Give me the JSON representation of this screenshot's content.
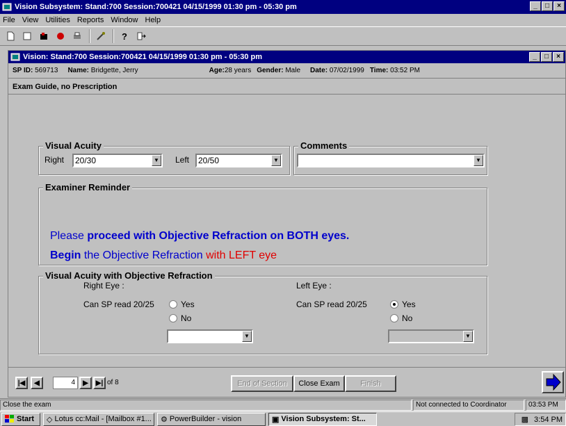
{
  "app": {
    "title": "Vision Subsystem: Stand:700 Session:700421 04/15/1999 01:30 pm - 05:30 pm",
    "window_buttons": [
      "_",
      "□",
      "×"
    ]
  },
  "menu": [
    "File",
    "View",
    "Utilities",
    "Reports",
    "Window",
    "Help"
  ],
  "toolbar_icons": [
    "new-icon",
    "open-icon",
    "save-icon",
    "stop-icon",
    "print-icon",
    "tools-icon",
    "help-icon",
    "exit-icon"
  ],
  "child": {
    "title": "Vision: Stand:700 Session:700421 04/15/1999 01:30 pm - 05:30 pm",
    "info": {
      "sp_id_label": "SP ID:",
      "sp_id": "569713",
      "name_label": "Name:",
      "name": "Bridgette, Jerry",
      "age_label": "Age:",
      "age": "28 years",
      "gender_label": "Gender:",
      "gender": "Male",
      "date_label": "Date:",
      "date": "07/02/1999",
      "time_label": "Time:",
      "time": "03:52 PM"
    },
    "section_title": "Exam Guide, no Prescription",
    "visual_acuity": {
      "label": "Visual Acuity",
      "right_label": "Right",
      "right_value": "20/30",
      "left_label": "Left",
      "left_value": "20/50"
    },
    "comments": {
      "label": "Comments",
      "value": ""
    },
    "reminder": {
      "label": "Examiner Reminder",
      "line1_part1": "Please ",
      "line1_part2": "proceed with Objective Refraction on BOTH eyes.",
      "line2_part1": "Begin ",
      "line2_part2": "the Objective Refraction ",
      "line2_part3": "with LEFT eye"
    },
    "va_objective": {
      "label": "Visual Acuity with Objective Refraction",
      "right_eye_label": "Right Eye :",
      "left_eye_label": "Left Eye :",
      "question": "Can SP read 20/25",
      "yes": "Yes",
      "no": "No",
      "right_selected": "none",
      "left_selected": "Yes",
      "right_combo_value": "",
      "left_combo_value": ""
    },
    "nav": {
      "page": "4",
      "of_label": "of 8",
      "end_section": "End of Section",
      "close_exam": "Close Exam",
      "finish": "Finish"
    }
  },
  "status": {
    "message": "Close the exam",
    "connection": "Not connected to Coordinator",
    "time": "03:53 PM"
  },
  "taskbar": {
    "start": "Start",
    "tasks": [
      "Lotus cc:Mail - [Mailbox #1...",
      "PowerBuilder - vision",
      "Vision Subsystem: St..."
    ],
    "clock": "3:54 PM"
  },
  "colors": {
    "titlebar": "#000080",
    "face": "#c0c0c0",
    "reminder_blue": "#0000cc",
    "reminder_red": "#e00000"
  }
}
